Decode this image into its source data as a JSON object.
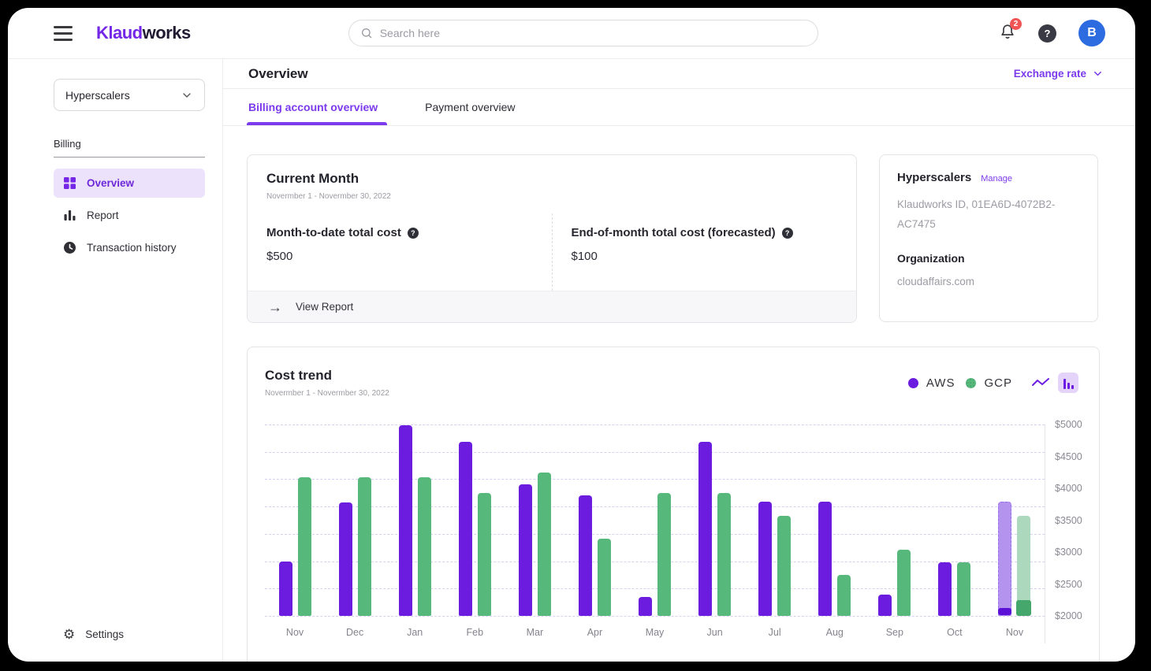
{
  "header": {
    "logo_part1": "Klaud",
    "logo_part2": "works",
    "search_placeholder": "Search here",
    "notification_count": "2",
    "help_label": "?",
    "avatar_initial": "B"
  },
  "sidebar": {
    "scope_selector": "Hyperscalers",
    "section_label": "Billing",
    "items": [
      {
        "label": "Overview",
        "icon": "grid-icon",
        "active": true
      },
      {
        "label": "Report",
        "icon": "bar-chart-icon",
        "active": false
      },
      {
        "label": "Transaction history",
        "icon": "clock-icon",
        "active": false
      }
    ],
    "settings_label": "Settings"
  },
  "page": {
    "title": "Overview",
    "exchange_rate_label": "Exchange rate",
    "tabs": [
      {
        "label": "Billing account overview",
        "active": true
      },
      {
        "label": "Payment overview",
        "active": false
      }
    ]
  },
  "current_month_card": {
    "title": "Current Month",
    "date_range": "Novermber 1 - Novermber 30, 2022",
    "metrics": [
      {
        "label": "Month-to-date total cost",
        "value": "$500"
      },
      {
        "label": "End-of-month total cost (forecasted)",
        "value": "$100"
      }
    ],
    "footer_action": "View Report"
  },
  "account_card": {
    "title": "Hyperscalers",
    "manage_label": "Manage",
    "account_id": "Klaudworks ID, 01EA6D-4072B2-AC7475",
    "org_label": "Organization",
    "org_value": "cloudaffairs.com"
  },
  "colors": {
    "brand_purple": "#7527e8",
    "accent_purple": "#7c3aed",
    "aws_bar": "#6c1cdf",
    "gcp_bar": "#57b87c",
    "avatar_blue": "#2d6be0",
    "badge_red": "#f05454",
    "active_item_bg": "#ede2fb"
  },
  "chart_data": {
    "type": "bar",
    "title": "Cost trend",
    "subtitle": "Novermber 1 - Novermber 30, 2022",
    "categories": [
      "Nov",
      "Dec",
      "Jan",
      "Feb",
      "Mar",
      "Apr",
      "May",
      "Jun",
      "Jul",
      "Aug",
      "Sep",
      "Oct",
      "Nov"
    ],
    "series": [
      {
        "name": "AWS",
        "color": "#6c1cdf",
        "light_color": "#b493ee",
        "cap_color": "#5c12d6",
        "values": [
          2850,
          3780,
          5000,
          4740,
          4070,
          3900,
          2300,
          4740,
          3800,
          3800,
          2330,
          2840,
          3800
        ]
      },
      {
        "name": "GCP",
        "color": "#57b87c",
        "light_color": "#acd8be",
        "cap_color": "#45a76c",
        "values": [
          4180,
          4180,
          4180,
          3940,
          4260,
          3210,
          3940,
          3940,
          3575,
          2650,
          3045,
          2840,
          3575
        ]
      }
    ],
    "forecast": {
      "index": 12,
      "note": "last Nov column rendered as faded forecast bars with solid actual-to-date caps",
      "actuals": {
        "AWS": 2110,
        "GCP": 2250
      }
    },
    "ylim": [
      2000,
      5000
    ],
    "y_tick_labels": [
      "$5000",
      "$4500",
      "$4000",
      "$3500",
      "$3000",
      "$2500",
      "$2000"
    ],
    "grid": "dashed horizontal",
    "legend_position": "top-right"
  }
}
